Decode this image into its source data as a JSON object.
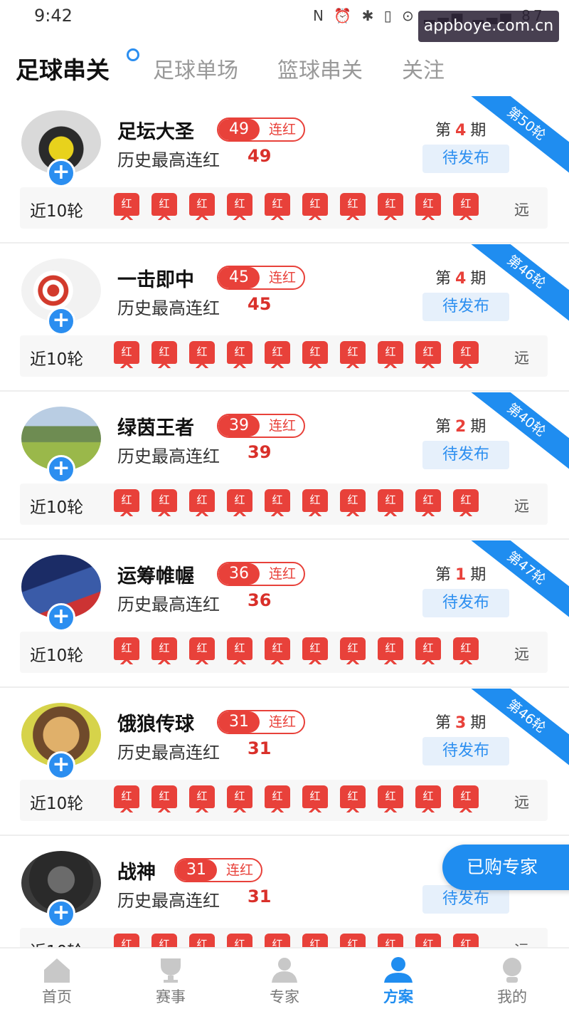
{
  "status_bar": {
    "time": "9:42",
    "icons": "N ⏰ ✱ ▯ ⊙ ▂▃▅ ▂▃▅ 87"
  },
  "watermark": "appboye.com.cn",
  "tabs": [
    {
      "label": "足球串关",
      "active": true
    },
    {
      "label": "足球单场",
      "active": false
    },
    {
      "label": "篮球串关",
      "active": false
    },
    {
      "label": "关注",
      "active": false
    }
  ],
  "common": {
    "streak_suffix": "连红",
    "history_label": "历史最高连红",
    "issue_prefix": "第",
    "issue_suffix": "期",
    "status": "待发布",
    "rounds_label": "近10轮",
    "badge_text": "红",
    "far_label": "远"
  },
  "experts": [
    {
      "name": "足坛大圣",
      "streak": "49",
      "history": "49",
      "issue": "4",
      "ribbon": "第50轮"
    },
    {
      "name": "一击即中",
      "streak": "45",
      "history": "45",
      "issue": "4",
      "ribbon": "第46轮"
    },
    {
      "name": "绿茵王者",
      "streak": "39",
      "history": "39",
      "issue": "2",
      "ribbon": "第40轮"
    },
    {
      "name": "运筹帷幄",
      "streak": "36",
      "history": "36",
      "issue": "1",
      "ribbon": "第47轮"
    },
    {
      "name": "饿狼传球",
      "streak": "31",
      "history": "31",
      "issue": "3",
      "ribbon": "第46轮"
    },
    {
      "name": "战神",
      "streak": "31",
      "history": "31",
      "issue": "",
      "ribbon": ""
    }
  ],
  "purchased_button": "已购专家",
  "bottom_nav": [
    {
      "label": "首页",
      "icon": "home-icon",
      "active": false
    },
    {
      "label": "赛事",
      "icon": "trophy-icon",
      "active": false
    },
    {
      "label": "专家",
      "icon": "expert-icon",
      "active": false
    },
    {
      "label": "方案",
      "icon": "plan-icon",
      "active": true
    },
    {
      "label": "我的",
      "icon": "profile-icon",
      "active": false
    }
  ],
  "colors": {
    "accent": "#1f8df0",
    "red": "#e8413a"
  }
}
